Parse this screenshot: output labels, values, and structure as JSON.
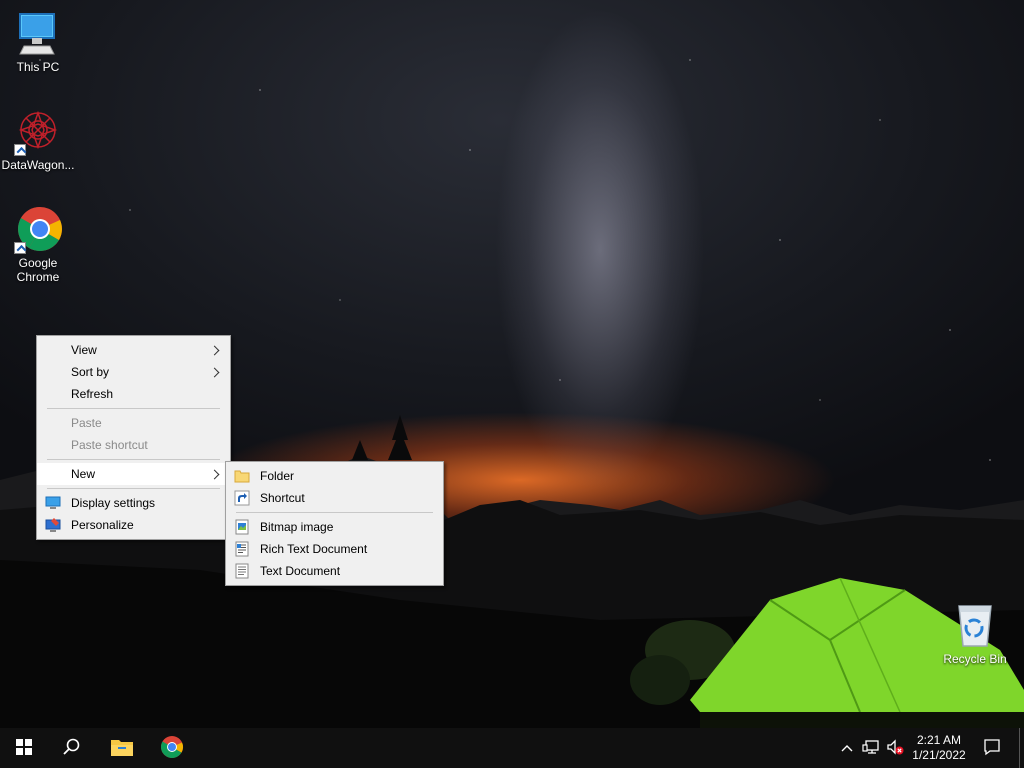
{
  "desktop_icons": {
    "this_pc": "This PC",
    "datawagon": "DataWagon...",
    "chrome_line1": "Google",
    "chrome_line2": "Chrome",
    "recycle_bin": "Recycle Bin"
  },
  "context_menu": {
    "view": "View",
    "sort_by": "Sort by",
    "refresh": "Refresh",
    "paste": "Paste",
    "paste_shortcut": "Paste shortcut",
    "new": "New",
    "display_settings": "Display settings",
    "personalize": "Personalize"
  },
  "new_submenu": {
    "folder": "Folder",
    "shortcut": "Shortcut",
    "bitmap_image": "Bitmap image",
    "rich_text_document": "Rich Text Document",
    "text_document": "Text Document"
  },
  "taskbar": {
    "time": "2:21 AM",
    "date": "1/21/2022"
  },
  "colors": {
    "tent_green": "#7fd62b",
    "menu_bg": "#f0f0f0",
    "taskbar_bg": "#101010"
  }
}
